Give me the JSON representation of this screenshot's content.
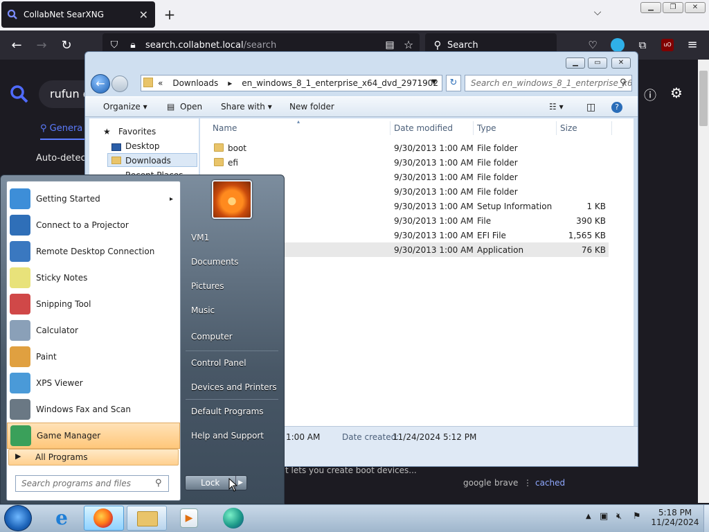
{
  "browser": {
    "tab_title": "CollabNet SearXNG",
    "url_domain": "search.collabnet.local",
    "url_path": "/search",
    "search_placeholder": "Search"
  },
  "page": {
    "query_text": "rufun d",
    "tab_general": "Genera",
    "auto_detect": "Auto-detect",
    "snippet": "t lets you create boot devices...",
    "engines": [
      "google",
      "brave"
    ],
    "cached_link": "cached"
  },
  "explorer": {
    "breadcrumb": [
      "«",
      "Downloads",
      "▸",
      "en_windows_8_1_enterprise_x64_dvd_2971902",
      "▸"
    ],
    "search_placeholder": "Search en_windows_8_1_enterprise_x6...",
    "toolbar": {
      "organize": "Organize ▾",
      "open": "Open",
      "share_with": "Share with ▾",
      "new_folder": "New folder"
    },
    "nav": {
      "favorites": "Favorites",
      "desktop": "Desktop",
      "downloads": "Downloads",
      "recent": "Recent Places"
    },
    "columns": {
      "name": "Name",
      "date": "Date modified",
      "type": "Type",
      "size": "Size"
    },
    "files": [
      {
        "name": "boot",
        "date": "9/30/2013 1:00 AM",
        "type": "File folder",
        "size": ""
      },
      {
        "name": "efi",
        "date": "9/30/2013 1:00 AM",
        "type": "File folder",
        "size": ""
      },
      {
        "name": "",
        "date": "9/30/2013 1:00 AM",
        "type": "File folder",
        "size": ""
      },
      {
        "name": "",
        "date": "9/30/2013 1:00 AM",
        "type": "File folder",
        "size": ""
      },
      {
        "name": "",
        "date": "9/30/2013 1:00 AM",
        "type": "Setup Information",
        "size": "1 KB"
      },
      {
        "name": "",
        "date": "9/30/2013 1:00 AM",
        "type": "File",
        "size": "390 KB"
      },
      {
        "name": "",
        "date": "9/30/2013 1:00 AM",
        "type": "EFI File",
        "size": "1,565 KB"
      },
      {
        "name": "",
        "date": "9/30/2013 1:00 AM",
        "type": "Application",
        "size": "76 KB"
      }
    ],
    "details": {
      "modified_fragment": "1:00 AM",
      "date_created_label": "Date created:",
      "date_created_value": "11/24/2024 5:12 PM"
    }
  },
  "start_menu": {
    "programs": [
      {
        "label": "Getting Started",
        "icon": "getting-started-icon",
        "color": "#3d8ed8",
        "arrow": "▸"
      },
      {
        "label": "Connect to a Projector",
        "icon": "projector-icon",
        "color": "#2f6fb8",
        "arrow": ""
      },
      {
        "label": "Remote Desktop Connection",
        "icon": "remote-desktop-icon",
        "color": "#3a78c0",
        "arrow": ""
      },
      {
        "label": "Sticky Notes",
        "icon": "sticky-notes-icon",
        "color": "#e8e27a",
        "arrow": ""
      },
      {
        "label": "Snipping Tool",
        "icon": "snipping-tool-icon",
        "color": "#d04848",
        "arrow": ""
      },
      {
        "label": "Calculator",
        "icon": "calculator-icon",
        "color": "#8aa0b8",
        "arrow": ""
      },
      {
        "label": "Paint",
        "icon": "paint-icon",
        "color": "#e0a040",
        "arrow": ""
      },
      {
        "label": "XPS Viewer",
        "icon": "xps-viewer-icon",
        "color": "#4a9ad8",
        "arrow": ""
      },
      {
        "label": "Windows Fax and Scan",
        "icon": "fax-scan-icon",
        "color": "#6a7884",
        "arrow": ""
      },
      {
        "label": "Game Manager",
        "icon": "game-manager-icon",
        "color": "#3aa05a",
        "arrow": ""
      }
    ],
    "all_programs": "All Programs",
    "search_placeholder": "Search programs and files",
    "right_items": [
      "VM1",
      "Documents",
      "Pictures",
      "Music",
      "Computer",
      "Control Panel",
      "Devices and Printers",
      "Default Programs",
      "Help and Support"
    ],
    "lock": "Lock"
  },
  "taskbar": {
    "apps": [
      "start-orb-icon",
      "internet-explorer-icon",
      "firefox-icon",
      "file-explorer-icon",
      "media-player-icon",
      "edge-icon"
    ],
    "time": "5:18 PM",
    "date": "11/24/2024"
  }
}
